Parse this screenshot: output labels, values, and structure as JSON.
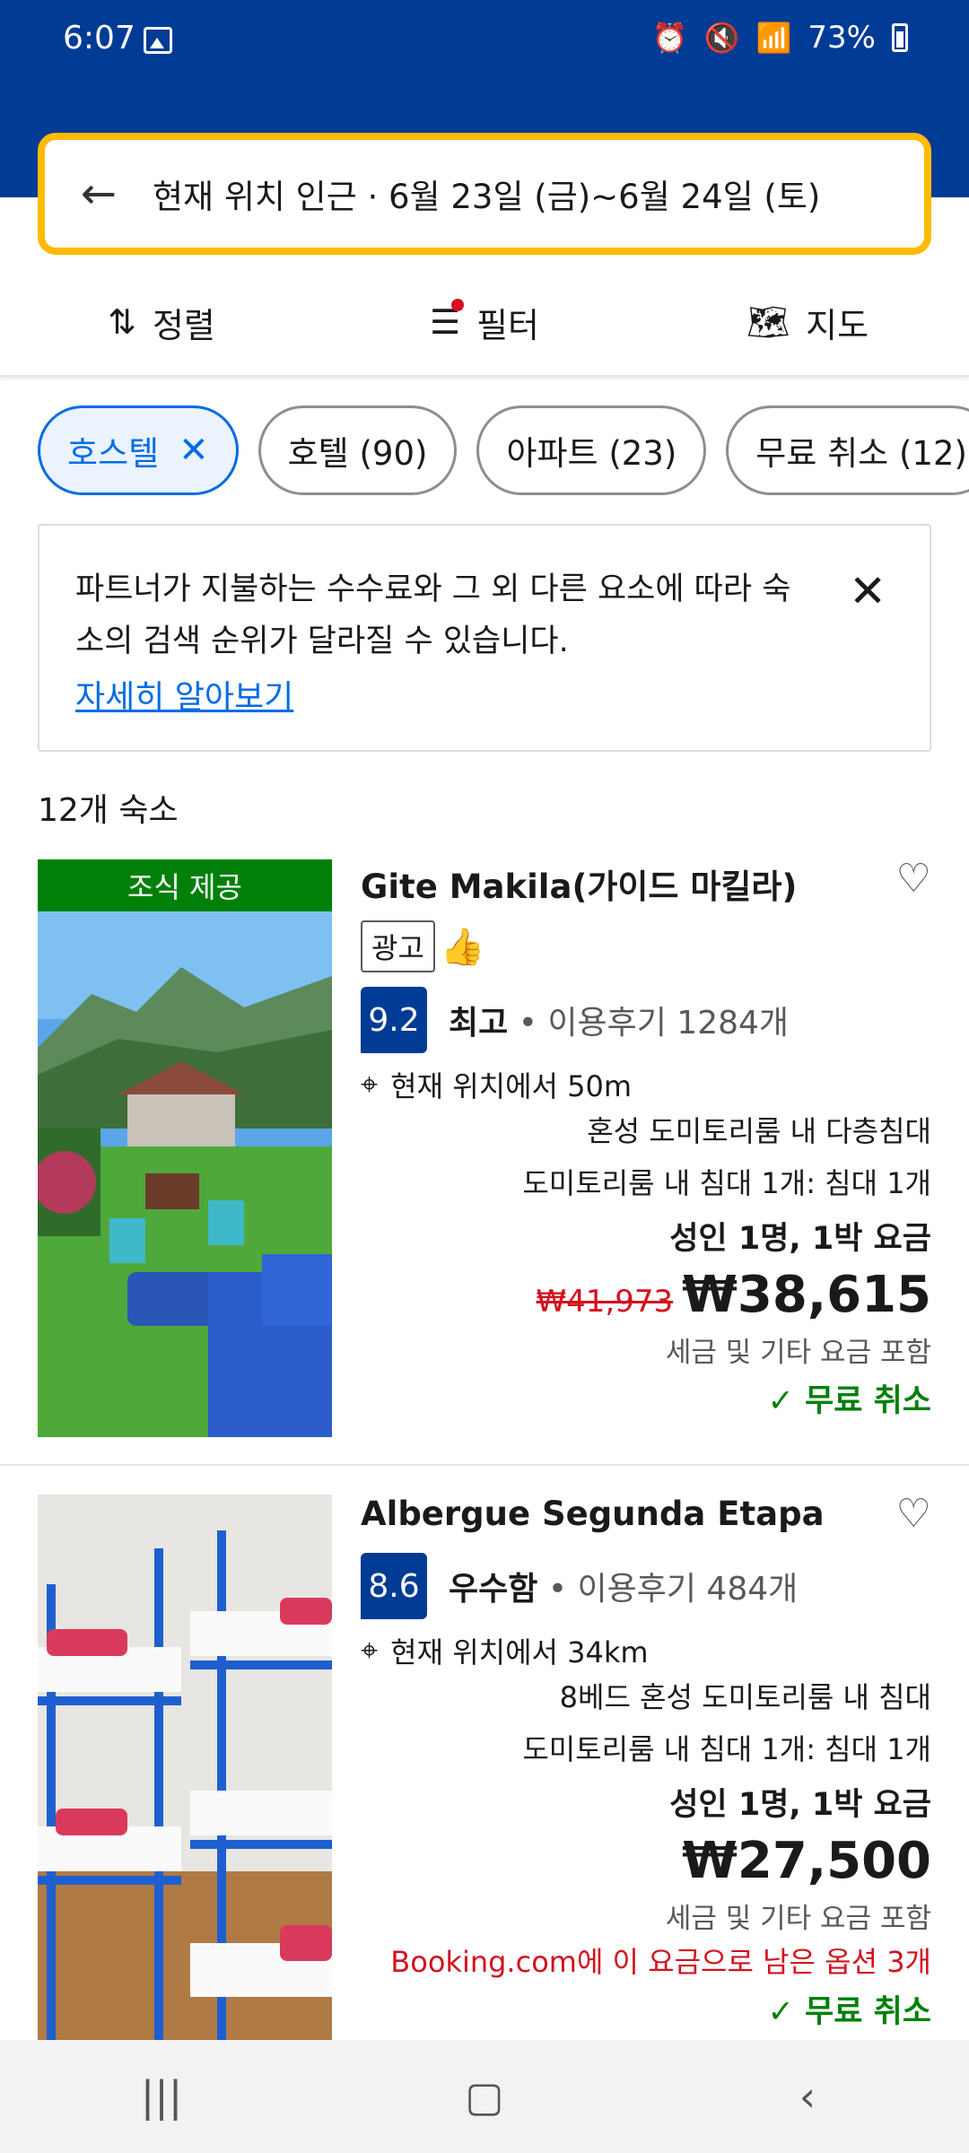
{
  "status": {
    "time": "6:07",
    "battery": "73%"
  },
  "search": {
    "summary": "현재 위치 인근 · 6월 23일 (금)~6월 24일 (토)"
  },
  "toolbar": {
    "sort": "정렬",
    "filter": "필터",
    "map": "지도"
  },
  "chips": [
    {
      "label": "호스텔",
      "active": true
    },
    {
      "label": "호텔 (90)"
    },
    {
      "label": "아파트 (23)"
    },
    {
      "label": "무료 취소 (12)"
    }
  ],
  "notice": {
    "text": "파트너가 지불하는 수수료와 그 외 다른 요소에 따라 숙소의 검색 순위가 달라질 수 있습니다.",
    "link": "자세히 알아보기"
  },
  "results_count": "12개 숙소",
  "listings": [
    {
      "badge": "조식 제공",
      "name": "Gite Makila(가이드 마킬라)",
      "ad_label": "광고",
      "score": "9.2",
      "score_word": "최고",
      "reviews": "• 이용후기 1284개",
      "distance": "현재 위치에서 50m",
      "room_type": "혼성 도미토리룸 내 다층침대",
      "bed": "도미토리룸 내 침대 1개: 침대 1개",
      "price_for": "성인 1명, 1박 요금",
      "old_price": "₩41,973",
      "price": "₩38,615",
      "tax": "세금 및 기타 요금 포함",
      "cancel": "✓ 무료 취소"
    },
    {
      "name": "Albergue Segunda Etapa",
      "score": "8.6",
      "score_word": "우수함",
      "reviews": "• 이용후기 484개",
      "distance": "현재 위치에서 34km",
      "room_type": "8베드 혼성 도미토리룸 내 침대",
      "bed": "도미토리룸 내 침대 1개: 침대 1개",
      "price_for": "성인 1명, 1박 요금",
      "price": "₩27,500",
      "tax": "세금 및 기타 요금 포함",
      "availability": "Booking.com에 이 요금으로 남은 옵션 3개",
      "cancel": "✓ 무료 취소"
    }
  ]
}
